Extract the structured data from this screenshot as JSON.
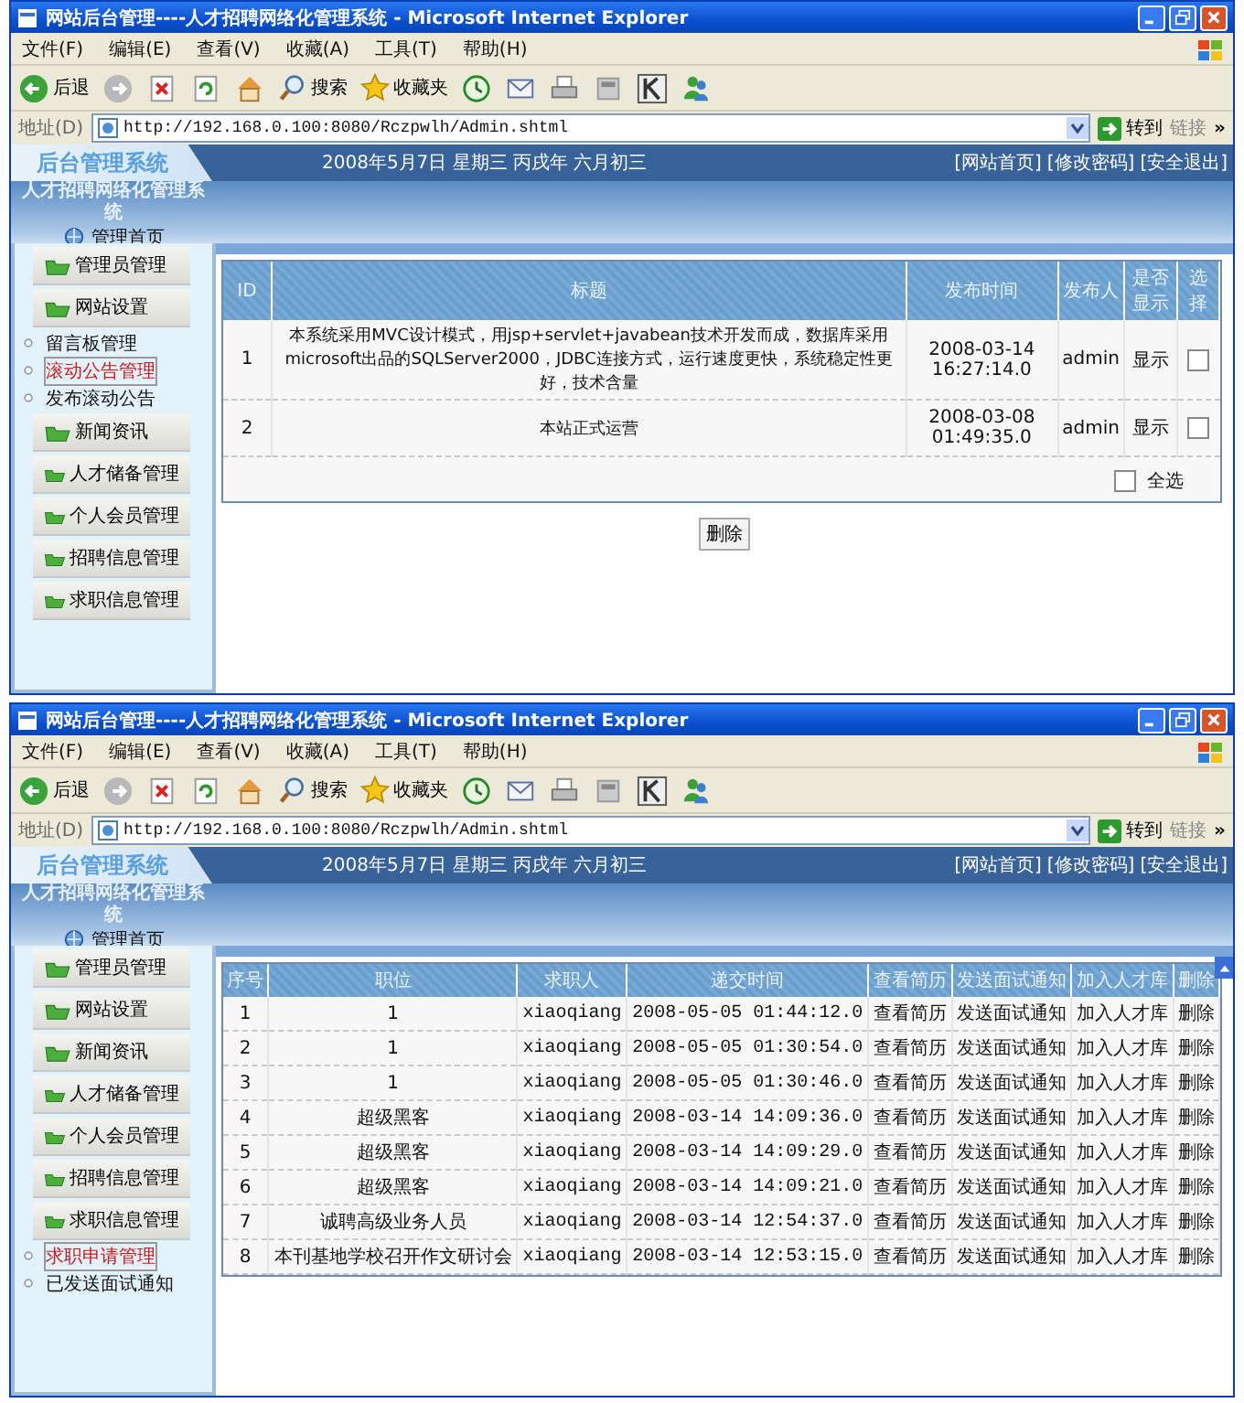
{
  "windows": [
    {
      "title": "网站后台管理----人才招聘网络化管理系统 - Microsoft Internet Explorer",
      "menu": [
        "文件(F)",
        "编辑(E)",
        "查看(V)",
        "收藏(A)",
        "工具(T)",
        "帮助(H)"
      ],
      "toolbar": {
        "back": "后退",
        "search": "搜索",
        "favorites": "收藏夹"
      },
      "address": {
        "label": "地址(D)",
        "url": "http://192.168.0.100:8080/Rczpwlh/Admin.shtml",
        "go": "转到",
        "links": "链接",
        "more": "»"
      },
      "header": {
        "logo": "后台管理系统",
        "date": "2008年5月7日 星期三 丙戌年 六月初三",
        "links": [
          "[网站首页]",
          "[修改密码]",
          "[安全退出]"
        ]
      },
      "system_title": "人才招聘网络化管理系统",
      "home": "管理首页",
      "sidebar": [
        {
          "kind": "section",
          "label": "管理员管理"
        },
        {
          "kind": "section",
          "label": "网站设置"
        },
        {
          "kind": "link",
          "label": "留言板管理",
          "selected": false
        },
        {
          "kind": "link",
          "label": "滚动公告管理",
          "selected": true
        },
        {
          "kind": "link",
          "label": "发布滚动公告",
          "selected": false
        },
        {
          "kind": "section",
          "label": "新闻资讯"
        },
        {
          "kind": "section",
          "label": "人才储备管理"
        },
        {
          "kind": "section",
          "label": "个人会员管理"
        },
        {
          "kind": "section",
          "label": "招聘信息管理"
        },
        {
          "kind": "section",
          "label": "求职信息管理"
        }
      ],
      "main": {
        "kind": "notices",
        "scrollbar": false,
        "columns": [
          {
            "label": "ID",
            "kind": "text"
          },
          {
            "label": "标题",
            "kind": "text"
          },
          {
            "label": "发布时间",
            "kind": "text"
          },
          {
            "label": "发布人",
            "kind": "text"
          },
          {
            "label": "是否显示",
            "kind": "text"
          },
          {
            "label": "选择",
            "kind": "checkbox"
          }
        ],
        "rows": [
          {
            "cells": [
              "1",
              "本系统采用MVC设计模式，用jsp+servlet+javabean技术开发而成，数据库采用microsoft出品的SQLServer2000，JDBC连接方式，运行速度更快，系统稳定性更好，技术含量",
              "2008-03-14 16:27:14.0",
              "admin",
              "显示"
            ],
            "checked": false
          },
          {
            "cells": [
              "2",
              "本站正式运营",
              "2008-03-08 01:49:35.0",
              "admin",
              "显示"
            ],
            "checked": false
          }
        ],
        "select_all": {
          "label": "全选",
          "checked": false
        },
        "button": "删除"
      }
    },
    {
      "title": "网站后台管理----人才招聘网络化管理系统 - Microsoft Internet Explorer",
      "menu": [
        "文件(F)",
        "编辑(E)",
        "查看(V)",
        "收藏(A)",
        "工具(T)",
        "帮助(H)"
      ],
      "toolbar": {
        "back": "后退",
        "search": "搜索",
        "favorites": "收藏夹"
      },
      "address": {
        "label": "地址(D)",
        "url": "http://192.168.0.100:8080/Rczpwlh/Admin.shtml",
        "go": "转到",
        "links": "链接",
        "more": "»"
      },
      "header": {
        "logo": "后台管理系统",
        "date": "2008年5月7日 星期三 丙戌年 六月初三",
        "links": [
          "[网站首页]",
          "[修改密码]",
          "[安全退出]"
        ]
      },
      "system_title": "人才招聘网络化管理系统",
      "home": "管理首页",
      "sidebar": [
        {
          "kind": "section",
          "label": "管理员管理"
        },
        {
          "kind": "section",
          "label": "网站设置"
        },
        {
          "kind": "section",
          "label": "新闻资讯"
        },
        {
          "kind": "section",
          "label": "人才储备管理"
        },
        {
          "kind": "section",
          "label": "个人会员管理"
        },
        {
          "kind": "section",
          "label": "招聘信息管理"
        },
        {
          "kind": "section",
          "label": "求职信息管理"
        },
        {
          "kind": "link",
          "label": "求职申请管理",
          "selected": true
        },
        {
          "kind": "link",
          "label": "已发送面试通知",
          "selected": false
        }
      ],
      "main": {
        "kind": "applications",
        "scrollbar": true,
        "columns": [
          {
            "label": "序号",
            "kind": "text"
          },
          {
            "label": "职位",
            "kind": "text"
          },
          {
            "label": "求职人",
            "kind": "text"
          },
          {
            "label": "递交时间",
            "kind": "text"
          },
          {
            "label": "查看简历",
            "kind": "link"
          },
          {
            "label": "发送面试通知",
            "kind": "link"
          },
          {
            "label": "加入人才库",
            "kind": "link"
          },
          {
            "label": "删除",
            "kind": "link"
          }
        ],
        "rows": [
          {
            "cells": [
              "1",
              "1",
              "xiaoqiang",
              "2008-05-05 01:44:12.0",
              "查看简历",
              "发送面试通知",
              "加入人才库",
              "删除"
            ]
          },
          {
            "cells": [
              "2",
              "1",
              "xiaoqiang",
              "2008-05-05 01:30:54.0",
              "查看简历",
              "发送面试通知",
              "加入人才库",
              "删除"
            ]
          },
          {
            "cells": [
              "3",
              "1",
              "xiaoqiang",
              "2008-05-05 01:30:46.0",
              "查看简历",
              "发送面试通知",
              "加入人才库",
              "删除"
            ]
          },
          {
            "cells": [
              "4",
              "超级黑客",
              "xiaoqiang",
              "2008-03-14 14:09:36.0",
              "查看简历",
              "发送面试通知",
              "加入人才库",
              "删除"
            ]
          },
          {
            "cells": [
              "5",
              "超级黑客",
              "xiaoqiang",
              "2008-03-14 14:09:29.0",
              "查看简历",
              "发送面试通知",
              "加入人才库",
              "删除"
            ]
          },
          {
            "cells": [
              "6",
              "超级黑客",
              "xiaoqiang",
              "2008-03-14 14:09:21.0",
              "查看简历",
              "发送面试通知",
              "加入人才库",
              "删除"
            ]
          },
          {
            "cells": [
              "7",
              "诚聘高级业务人员",
              "xiaoqiang",
              "2008-03-14 12:54:37.0",
              "查看简历",
              "发送面试通知",
              "加入人才库",
              "删除"
            ]
          },
          {
            "cells": [
              "8",
              "本刊基地学校召开作文研讨会",
              "xiaoqiang",
              "2008-03-14 12:53:15.0",
              "查看简历",
              "发送面试通知",
              "加入人才库",
              "删除"
            ]
          }
        ]
      }
    }
  ]
}
